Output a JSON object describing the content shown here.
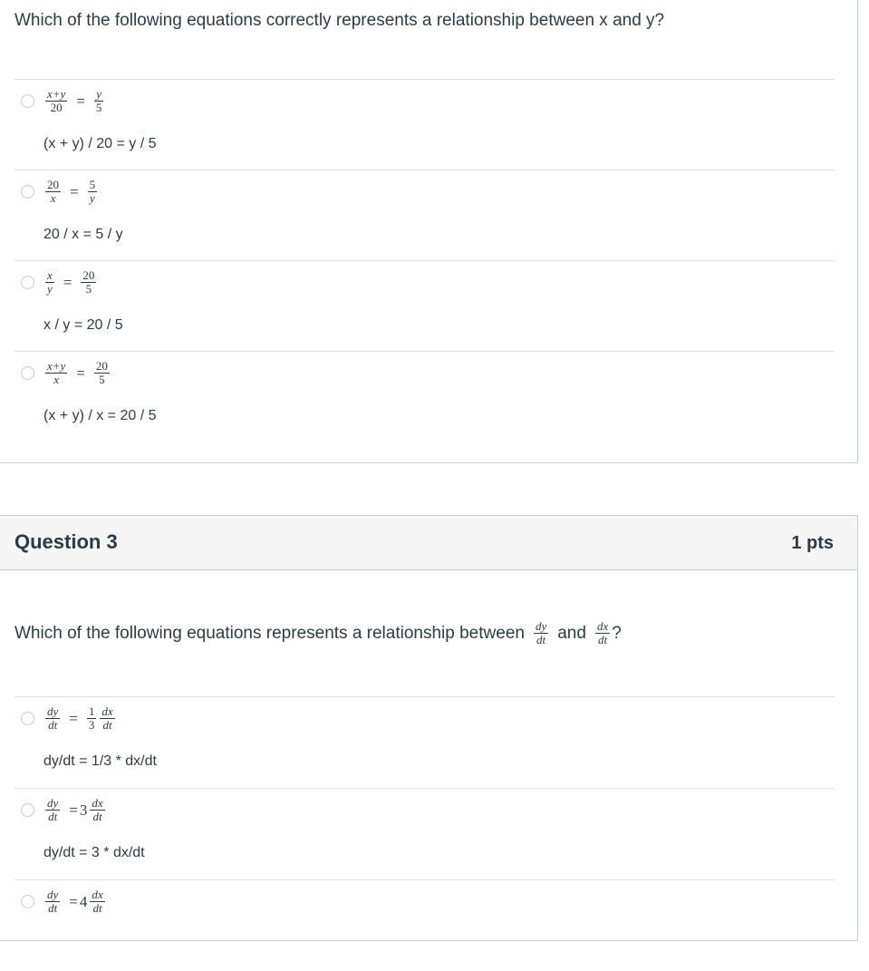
{
  "question2": {
    "prompt": "Which of the following equations correctly represents a relationship between x and y?",
    "answers": [
      {
        "lhs_num": "x+y",
        "lhs_den": "20",
        "rhs_num": "y",
        "rhs_den": "5",
        "text": "(x + y) / 20 = y / 5"
      },
      {
        "lhs_num": "20",
        "lhs_den": "x",
        "rhs_num": "5",
        "rhs_den": "y",
        "text": "20 / x = 5 / y"
      },
      {
        "lhs_num": "x",
        "lhs_den": "y",
        "rhs_num": "20",
        "rhs_den": "5",
        "text": "x / y = 20 / 5"
      },
      {
        "lhs_num": "x+y",
        "lhs_den": "x",
        "rhs_num": "20",
        "rhs_den": "5",
        "text": "(x + y) / x = 20 / 5"
      }
    ]
  },
  "question3": {
    "title": "Question 3",
    "points": "1 pts",
    "prompt_before": "Which of the following equations represents a relationship between",
    "prompt_and": "and",
    "prompt_end": "?",
    "frac1": {
      "num": "dy",
      "den": "dt"
    },
    "frac2": {
      "num": "dx",
      "den": "dt"
    },
    "answers": [
      {
        "lhs_num": "dy",
        "lhs_den": "dt",
        "coef_num": "1",
        "coef_den": "3",
        "rhs_num": "dx",
        "rhs_den": "dt",
        "text": "dy/dt = 1/3 * dx/dt"
      },
      {
        "lhs_num": "dy",
        "lhs_den": "dt",
        "coef": "3",
        "rhs_num": "dx",
        "rhs_den": "dt",
        "text": "dy/dt = 3 * dx/dt"
      },
      {
        "lhs_num": "dy",
        "lhs_den": "dt",
        "coef": "4",
        "rhs_num": "dx",
        "rhs_den": "dt",
        "text": ""
      }
    ]
  }
}
